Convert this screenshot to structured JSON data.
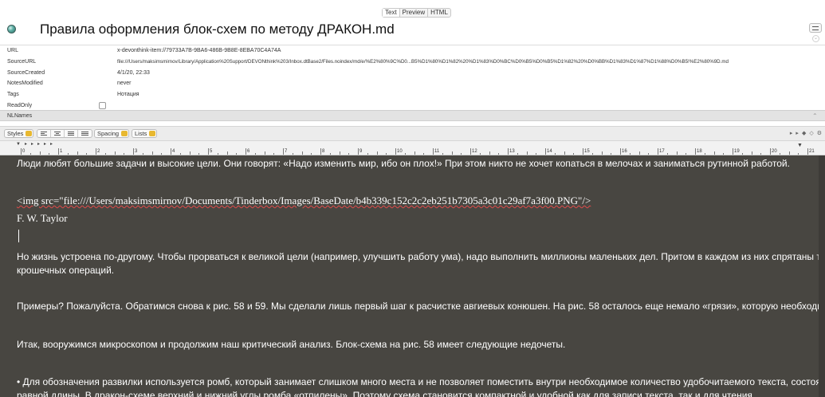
{
  "view_toggle": {
    "text": "Text",
    "preview": "Preview",
    "html": "HTML"
  },
  "document": {
    "title": "Правила оформления блок-схем по методу ДРАКОН.md"
  },
  "metadata": [
    {
      "key": "URL",
      "value": "x-devonthink-item://79733A7B-9BA6-486B-9B8E-8EBA70C4A74A"
    },
    {
      "key": "SourceURL",
      "value": "file:///Users/maksimsmirnov/Library/Application%20Support/DEVONthink%203/Inbox.dtBase2/Files.noindex/md/e/%E2%80%9C%D0...B5%D1%80%D1%82%20%D1%83%D0%BC%D0%B5%D0%B5%D1%82%20%D0%BB%D1%83%D1%87%D1%88%D0%B5!%E2%80%9D.md"
    },
    {
      "key": "SourceCreated",
      "value": "4/1/20, 22:33"
    },
    {
      "key": "NotesModified",
      "value": "never"
    },
    {
      "key": "Tags",
      "value": "Нотация"
    },
    {
      "key": "ReadOnly",
      "value": ""
    }
  ],
  "nlnames": {
    "key": "NLNames"
  },
  "format_toolbar": {
    "styles": "Styles",
    "spacing": "Spacing",
    "lists": "Lists"
  },
  "ruler": {
    "numbers": [
      "0",
      "1",
      "2",
      "3",
      "4",
      "5",
      "6",
      "7",
      "8",
      "9",
      "10",
      "11",
      "12",
      "13",
      "14",
      "15",
      "16",
      "17",
      "18",
      "19",
      "20",
      "21"
    ]
  },
  "editor": {
    "lines": [
      "Люди любят большие задачи и высокие цели. Они говорят: «Надо изменить мир, ибо он плох!» При этом никто не хочет копаться в мелочах и заниматься рутинной работой.",
      "<img src=\"file:///Users/maksimsmirnov/Documents/Tinderbox/Images/BaseDate/b4b339c152c2c2eb251b7305a3c01c29af7a3f00.PNG\"/>",
      "F. W. Taylor",
      "Но жизнь устроена по-другому. Чтобы прорваться к великой цели (например, улучшить работу ума), надо выполнить миллионы маленьких дел. Притом в каждом из них спрятаны тысячи совсем",
      "крошечных операций.",
      "Примеры? Пожалуйста. Обратимся снова к рис. 58 и 59. Мы сделали лишь первый шаг к расчистке авгиевых конюшен. На рис. 58 осталось еще немало «грязи», которую необходимо отмыть.",
      "Итак, вооружимся микроскопом и продолжим наш критический анализ. Блок-схема на рис. 58 имеет следующие недочеты.",
      "• Для обозначения развилки используется ромб, который занимает слишком много места и не позволяет поместить внутри необходимое количество удобочитаемого текста, состоящего из строк",
      "равной длины. В дракон-схеме верхний и нижний углы ромба «отпилены». Поэтому схема становится компактной и удобной как для записи текста, так и для чтения."
    ]
  }
}
